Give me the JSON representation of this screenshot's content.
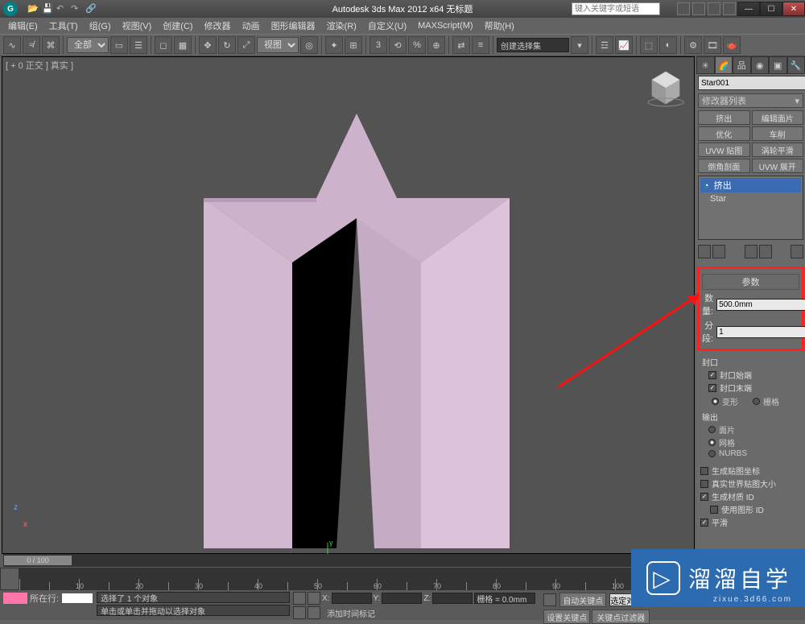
{
  "title": "Autodesk 3ds Max 2012 x64   无标题",
  "search_placeholder": "键入关键字或短语",
  "menus": [
    "编辑(E)",
    "工具(T)",
    "组(G)",
    "视图(V)",
    "创建(C)",
    "修改器",
    "动画",
    "图形编辑器",
    "渲染(R)",
    "自定义(U)",
    "MAXScript(M)",
    "帮助(H)"
  ],
  "toolbar": {
    "select_mode": "全部",
    "view_label": "视图",
    "named_sel": "创建选择集"
  },
  "viewport_label": "[ + 0 正交 ] 真实 ]",
  "command_panel": {
    "object_name": "Star001",
    "modlist_label": "修改器列表",
    "quick_mods": [
      [
        "挤出",
        "编辑面片"
      ],
      [
        "优化",
        "车削"
      ],
      [
        "UVW 贴图",
        "涡轮平滑"
      ],
      [
        "倒角剖面",
        "UVW 展开"
      ]
    ],
    "stack": {
      "selected": "挤出",
      "items": [
        "Star"
      ]
    },
    "rollout_title": "参数",
    "amount_label": "数量:",
    "amount_value": "500.0mm",
    "segments_label": "分段:",
    "segments_value": "1",
    "cap_section": "封口",
    "cap_start": "封口始端",
    "cap_end": "封口末端",
    "morph": "变形",
    "grid": "栅格",
    "output_label": "输出",
    "out_patch": "面片",
    "out_mesh": "网格",
    "out_nurbs": "NURBS",
    "gen_map": "生成贴图坐标",
    "real_world": "真实世界贴图大小",
    "gen_matid": "生成材质 ID",
    "use_shape": "使用图形 ID",
    "smooth": "平滑"
  },
  "time": {
    "slider": "0 / 100"
  },
  "status": {
    "sel": "选择了 1 个对象",
    "prompt": "单击或单击并拖动以选择对象",
    "add_marker": "添加时间标记",
    "grid": "栅格 = 0.0mm",
    "autokey": "自动关键点",
    "setkey": "设置关键点",
    "selset": "选定对象",
    "keyfilter": "关键点过滤器",
    "loc_label": "所在行:"
  },
  "brand": {
    "name": "溜溜自学",
    "url": "zixue.3d66.com"
  }
}
